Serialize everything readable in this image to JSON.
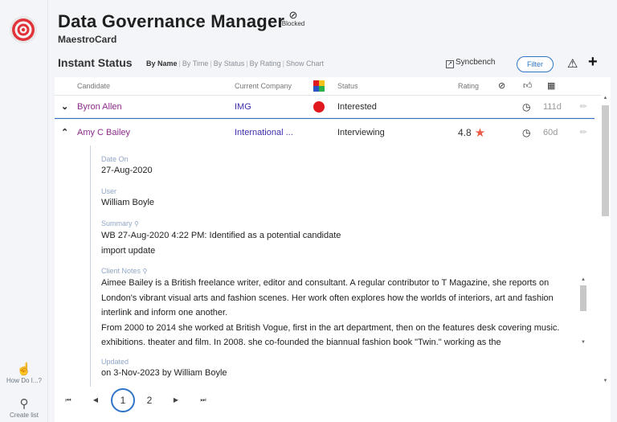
{
  "app": {
    "title": "Data Governance Manager",
    "blocked_label": "Blocked",
    "company": "MaestroCard",
    "logo": "target-logo"
  },
  "rail": {
    "how_do_i": "How Do I...?",
    "create_list": "Create list"
  },
  "status": {
    "title": "Instant Status",
    "tabs": [
      "By Name",
      "By Time",
      "By Status",
      "By Rating",
      "Show Chart"
    ],
    "active_tab": "By Name",
    "syncbench": "Syncbench",
    "filter": "Filter"
  },
  "columns": {
    "candidate": "Candidate",
    "company": "Current Company",
    "status": "Status",
    "rating": "Rating"
  },
  "rows": [
    {
      "candidate": "Byron Allen",
      "company": "IMG",
      "status": "Interested",
      "rating": "",
      "days": "111d",
      "status_color": "#e0191e"
    },
    {
      "candidate": "Amy C Bailey",
      "company": "International ...",
      "status": "Interviewing",
      "rating": "4.8",
      "days": "60d",
      "star_color": "#ea5a45"
    }
  ],
  "detail": {
    "date_on_label": "Date On",
    "date_on": "27-Aug-2020",
    "user_label": "User",
    "user": "William Boyle",
    "summary_label": "Summary",
    "summary_line1": "WB 27-Aug-2020 4:22 PM: Identified as a potential candidate",
    "summary_line2": "import update",
    "notes_label": "Client Notes",
    "notes_p1": "Aimee Bailey is a British freelance writer, editor and consultant. A regular contributor to T Magazine, she reports on London's vibrant visual arts and fashion scenes. Her work often explores how the worlds of interiors, art and fashion interlink and inform one another.",
    "notes_p2": "From 2000 to 2014 she worked at British Vogue, first in the art department, then on the features desk covering music. exhibitions. theater and film. In 2008. she co-founded the biannual fashion book \"Twin.\" working as the",
    "updated_label": "Updated",
    "updated": "on 3-Nov-2023 by William Boyle"
  },
  "pager": {
    "pages": [
      "1",
      "2"
    ],
    "current": "1"
  },
  "colors": {
    "accent": "#2f74c8",
    "candidate": "#8a2b8a",
    "company": "#3d2fae",
    "background": "#f3f5f8"
  }
}
